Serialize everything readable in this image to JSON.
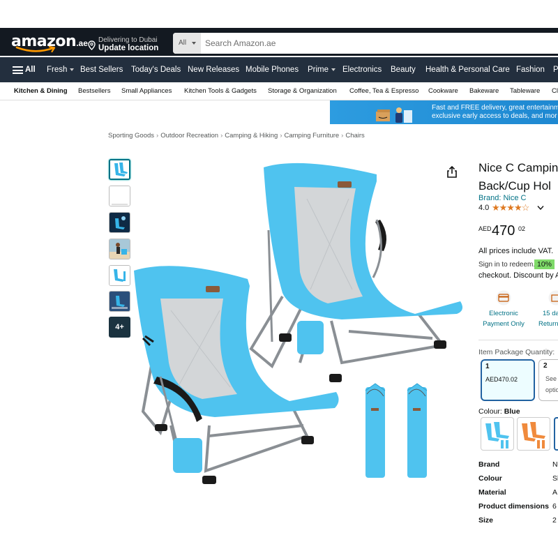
{
  "header": {
    "logo_text": "amazon",
    "logo_suffix": ".ae",
    "deliver_line1": "Delivering to Dubai",
    "deliver_line2": "Update location",
    "search_category": "All",
    "search_placeholder": "Search Amazon.ae"
  },
  "nav": {
    "all_label": "All",
    "items": [
      "Fresh",
      "Best Sellers",
      "Today's Deals",
      "New Releases",
      "Mobile Phones",
      "Prime",
      "Electronics",
      "Beauty",
      "Health & Personal Care",
      "Fashion",
      "P"
    ]
  },
  "subnav": {
    "items": [
      "Kitchen & Dining",
      "Bestsellers",
      "Small Appliances",
      "Kitchen Tools & Gadgets",
      "Storage & Organization",
      "Coffee, Tea & Espresso",
      "Cookware",
      "Bakeware",
      "Tableware",
      "Cl"
    ]
  },
  "banner": {
    "line1": "Fast and FREE delivery, great entertainm",
    "line2": "exclusive early access to deals, and mor"
  },
  "breadcrumb": [
    "Sporting Goods",
    "Outdoor Recreation",
    "Camping & Hiking",
    "Camping Furniture",
    "Chairs"
  ],
  "gallery": {
    "more_label": "4+"
  },
  "product": {
    "title_line1": "Nice C Campin",
    "title_line2": "Back/Cup Hol",
    "brand_link": "Brand: Nice C",
    "rating": "4.0",
    "stars": "★★★★☆",
    "price_currency": "AED",
    "price_whole": "470",
    "price_fraction": "02",
    "vat_note": "All prices include VAT.",
    "signin_note": "Sign in to redeem.",
    "discount_badge": "10%",
    "checkout_note": "checkout. Discount by A",
    "features": [
      {
        "line1": "Electronic",
        "line2": "Payment Only"
      },
      {
        "line1": "15 da",
        "line2": "Return"
      }
    ],
    "package_label": "Item Package Quantity:",
    "package_options": [
      {
        "qty": "1",
        "price": "AED470.02"
      },
      {
        "qty": "2",
        "line1": "See a",
        "line2": "optio"
      }
    ],
    "colour_label": "Colour:",
    "colour_value": "Blue",
    "specs": [
      {
        "key": "Brand",
        "value": "N"
      },
      {
        "key": "Colour",
        "value": "Sk"
      },
      {
        "key": "Material",
        "value": "A"
      },
      {
        "key": "Product dimensions",
        "value": "6"
      },
      {
        "key": "Size",
        "value": "2"
      }
    ]
  }
}
